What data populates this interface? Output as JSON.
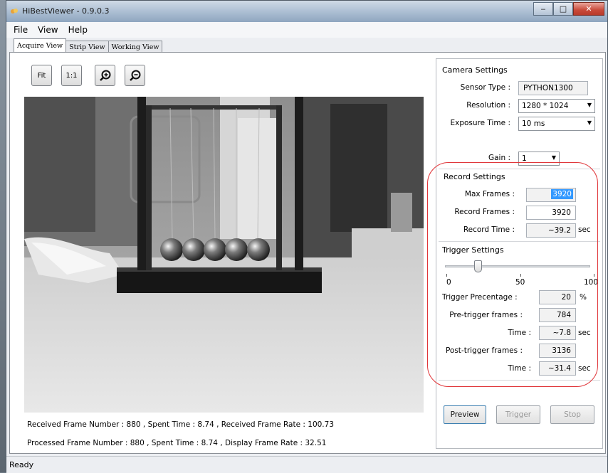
{
  "window": {
    "title": "HiBestViewer - 0.9.0.3"
  },
  "menu": [
    "File",
    "View",
    "Help"
  ],
  "tabs": [
    "Acquire View",
    "Strip View",
    "Working View"
  ],
  "toolbar": {
    "fit": "Fit",
    "one_to_one": "1:1",
    "zoom_in_icon": "zoom-in-icon",
    "zoom_out_icon": "zoom-out-icon"
  },
  "info": {
    "received": "Received Frame Number : 880 , Spent Time : 8.74 , Received Frame Rate : 100.73",
    "processed": "Processed Frame Number : 880 , Spent Time : 8.74 ,  Display Frame Rate : 32.51"
  },
  "camera": {
    "title": "Camera Settings",
    "sensor_label": "Sensor Type :",
    "sensor_value": "PYTHON1300",
    "resolution_label": "Resolution :",
    "resolution_value": "1280 * 1024",
    "exposure_label": "Exposure Time :",
    "exposure_value": "10 ms",
    "gain_label": "Gain :",
    "gain_value": "1"
  },
  "record": {
    "title": "Record Settings",
    "max_label": "Max Frames :",
    "max_value": "3920",
    "frames_label": "Record Frames :",
    "frames_value": "3920",
    "time_label": "Record Time :",
    "time_value": "~39.2",
    "unit": "sec"
  },
  "trigger": {
    "title": "Trigger Settings",
    "slider_value": 20,
    "scale": [
      "0",
      "50",
      "100"
    ],
    "pct_label": "Trigger Precentage :",
    "pct_value": "20",
    "pct_unit": "%",
    "pre_label": "Pre-trigger frames :",
    "pre_value": "784",
    "pre_time_label": "Time :",
    "pre_time_value": "~7.8",
    "pre_time_unit": "sec",
    "post_label": "Post-trigger frames :",
    "post_value": "3136",
    "post_time_label": "Time :",
    "post_time_value": "~31.4",
    "post_time_unit": "sec"
  },
  "buttons": {
    "preview": "Preview",
    "trigger": "Trigger",
    "stop": "Stop"
  },
  "statusbar": "Ready",
  "colors": {
    "annotation": "#e0363a",
    "titlebar": "#aabdd2",
    "selection": "#3399ff"
  }
}
